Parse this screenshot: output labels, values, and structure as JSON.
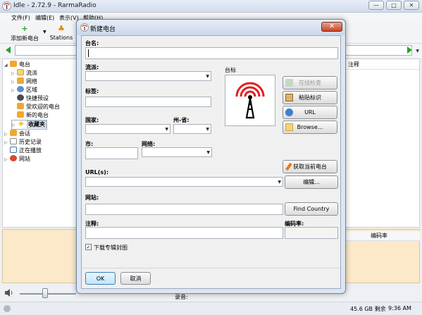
{
  "window": {
    "title": "Idle - 2.72.9 - RarmaRadio",
    "controls": [
      "—",
      "□",
      "✕"
    ]
  },
  "menu": [
    "文件(F)",
    "编辑(E)",
    "表示(V)",
    "帮助(H)"
  ],
  "toolbar": {
    "add_station": "添加新电台",
    "stations": "Stations"
  },
  "tree": {
    "items": [
      {
        "label": "电台",
        "level": 0,
        "expanded": true
      },
      {
        "label": "流派",
        "level": 1
      },
      {
        "label": "网络",
        "level": 1
      },
      {
        "label": "区域",
        "level": 1
      },
      {
        "label": "快捷预设",
        "level": 1
      },
      {
        "label": "受欢迎的电台",
        "level": 1
      },
      {
        "label": "新的电台",
        "level": 1
      },
      {
        "label": "收藏夹",
        "level": 1,
        "selected": true
      },
      {
        "label": "会话",
        "level": 0
      },
      {
        "label": "历史记录",
        "level": 0
      },
      {
        "label": "正在播放",
        "level": 0
      },
      {
        "label": "网站",
        "level": 0
      }
    ]
  },
  "right_panel": {
    "col_notes": "注释"
  },
  "bottom_panel": {
    "col_bitrate": "编码率"
  },
  "player": {
    "record_label": "录音:"
  },
  "status": {
    "disk": "45.6 GB 剩余",
    "time": "9:36 AM"
  },
  "dialog": {
    "title": "新建电台",
    "close": "✕",
    "name_label": "台名:",
    "name_value": "",
    "genre_label": "流派:",
    "logo_label": "台标",
    "tags_label": "标签:",
    "country_label": "国家:",
    "state_label": "州-省:",
    "city_label": "市:",
    "network_label": "网络:",
    "url_label": "URL(s):",
    "website_label": "网站:",
    "notes_label": "注释:",
    "bitrate_label": "编码率:",
    "download_covers_label": "下载专辑封图",
    "download_covers_checked": true,
    "buttons": {
      "online_check": "在线检查",
      "paste_logo": "粘贴标识",
      "url": "URL",
      "browse": "Browse...",
      "get_current": "获取当前电台",
      "edit": "编辑...",
      "find_country": "Find Country",
      "ok": "OK",
      "cancel": "取消"
    }
  }
}
